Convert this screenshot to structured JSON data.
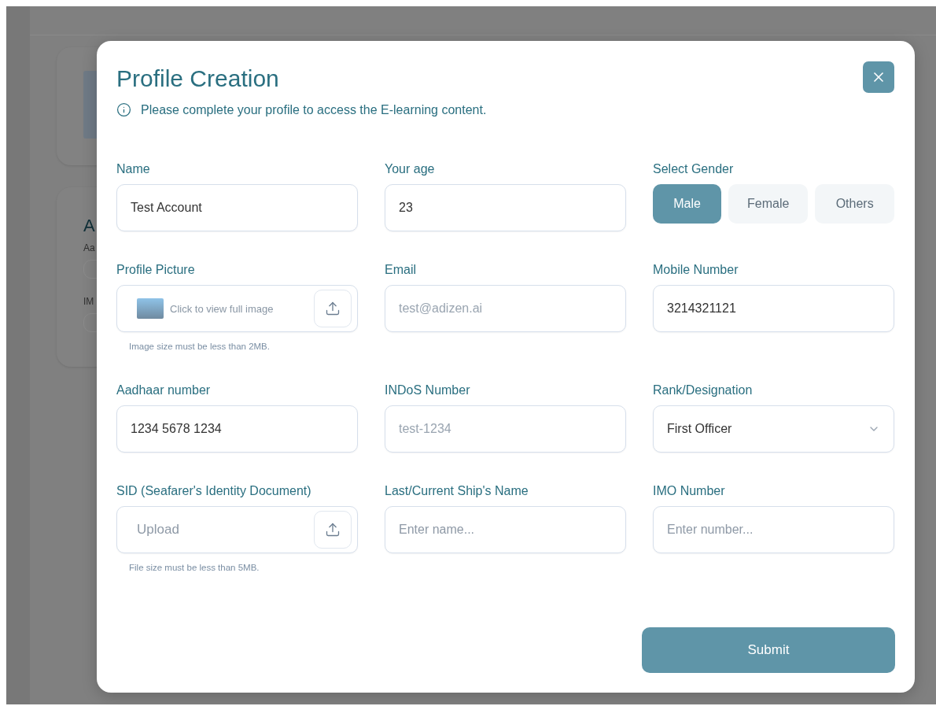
{
  "background": {
    "heading": "A",
    "labels": [
      "Aa",
      "IM"
    ]
  },
  "dialog": {
    "title": "Profile Creation",
    "notice": "Please complete your profile to access the E-learning content.",
    "fields": [
      {
        "kind": "text",
        "label": "Name",
        "value": "Test Account",
        "disabled": false
      },
      {
        "kind": "text",
        "label": "Your age",
        "value": "23",
        "disabled": false
      },
      {
        "kind": "gender",
        "label": "Select Gender",
        "options": [
          {
            "label": "Male",
            "selected": true
          },
          {
            "label": "Female",
            "selected": false
          },
          {
            "label": "Others",
            "selected": false
          }
        ]
      },
      {
        "kind": "image-upload",
        "label": "Profile Picture",
        "link": "Click to view full image",
        "helper": "Image size must be less than 2MB."
      },
      {
        "kind": "text",
        "label": "Email",
        "value": "test@adizen.ai",
        "disabled": true
      },
      {
        "kind": "text",
        "label": "Mobile Number",
        "value": "3214321121",
        "disabled": false
      },
      {
        "kind": "text",
        "label": "Aadhaar number",
        "value": "1234 5678 1234",
        "disabled": false
      },
      {
        "kind": "text",
        "label": "INDoS Number",
        "value": "test-1234",
        "disabled": true
      },
      {
        "kind": "select",
        "label": "Rank/Designation",
        "value": "First Officer"
      },
      {
        "kind": "upload",
        "label": "SID (Seafarer's Identity Document)",
        "placeholder": "Upload",
        "helper": "File size must be less than 5MB."
      },
      {
        "kind": "text",
        "label": "Last/Current Ship's Name",
        "placeholder": "Enter name..."
      },
      {
        "kind": "text",
        "label": "IMO Number",
        "placeholder": "Enter number..."
      }
    ],
    "submit": "Submit"
  }
}
